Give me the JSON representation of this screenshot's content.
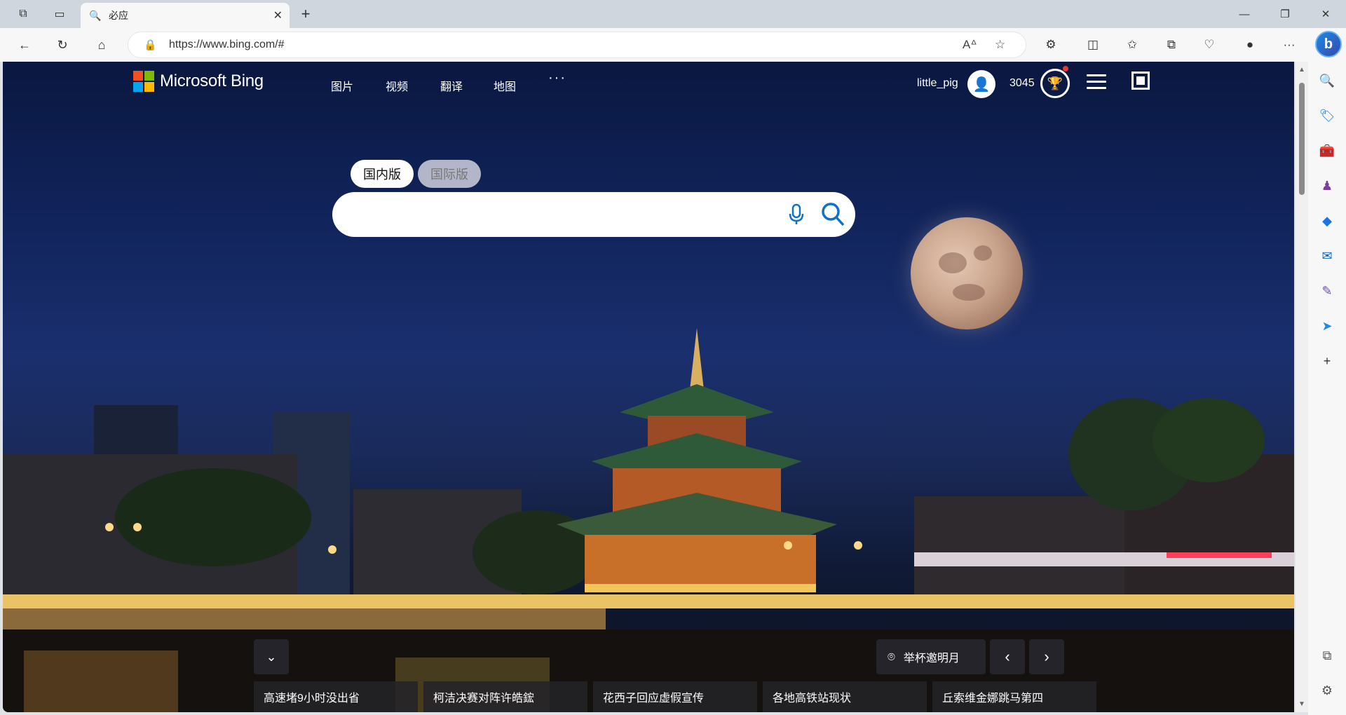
{
  "browser": {
    "tab": {
      "title": "必应",
      "favicon": "bing-search-icon"
    },
    "address_bar": {
      "url": "https://www.bing.com/#"
    },
    "window_controls": {
      "minimize": "—",
      "restore": "❐",
      "close": "✕"
    }
  },
  "bing": {
    "brand": "Microsoft Bing",
    "nav": {
      "images": "图片",
      "videos": "视频",
      "translate": "翻译",
      "maps": "地图",
      "more": "···"
    },
    "user": {
      "name": "little_pig",
      "points": "3045"
    },
    "version_tabs": {
      "domestic": "国内版",
      "international": "国际版"
    },
    "search": {
      "placeholder": "",
      "value": ""
    },
    "location_chip": {
      "label": "举杯邀明月"
    },
    "news": [
      "高速堵9小时没出省",
      "柯洁决赛对阵许皓鋐",
      "花西子回应虚假宣传",
      "各地高铁站现状",
      "丘索维金娜跳马第四"
    ]
  },
  "colors": {
    "accent": "#1170c7",
    "ms_red": "#f25022",
    "ms_green": "#7fba00",
    "ms_blue": "#00a4ef",
    "ms_yellow": "#ffb900"
  }
}
